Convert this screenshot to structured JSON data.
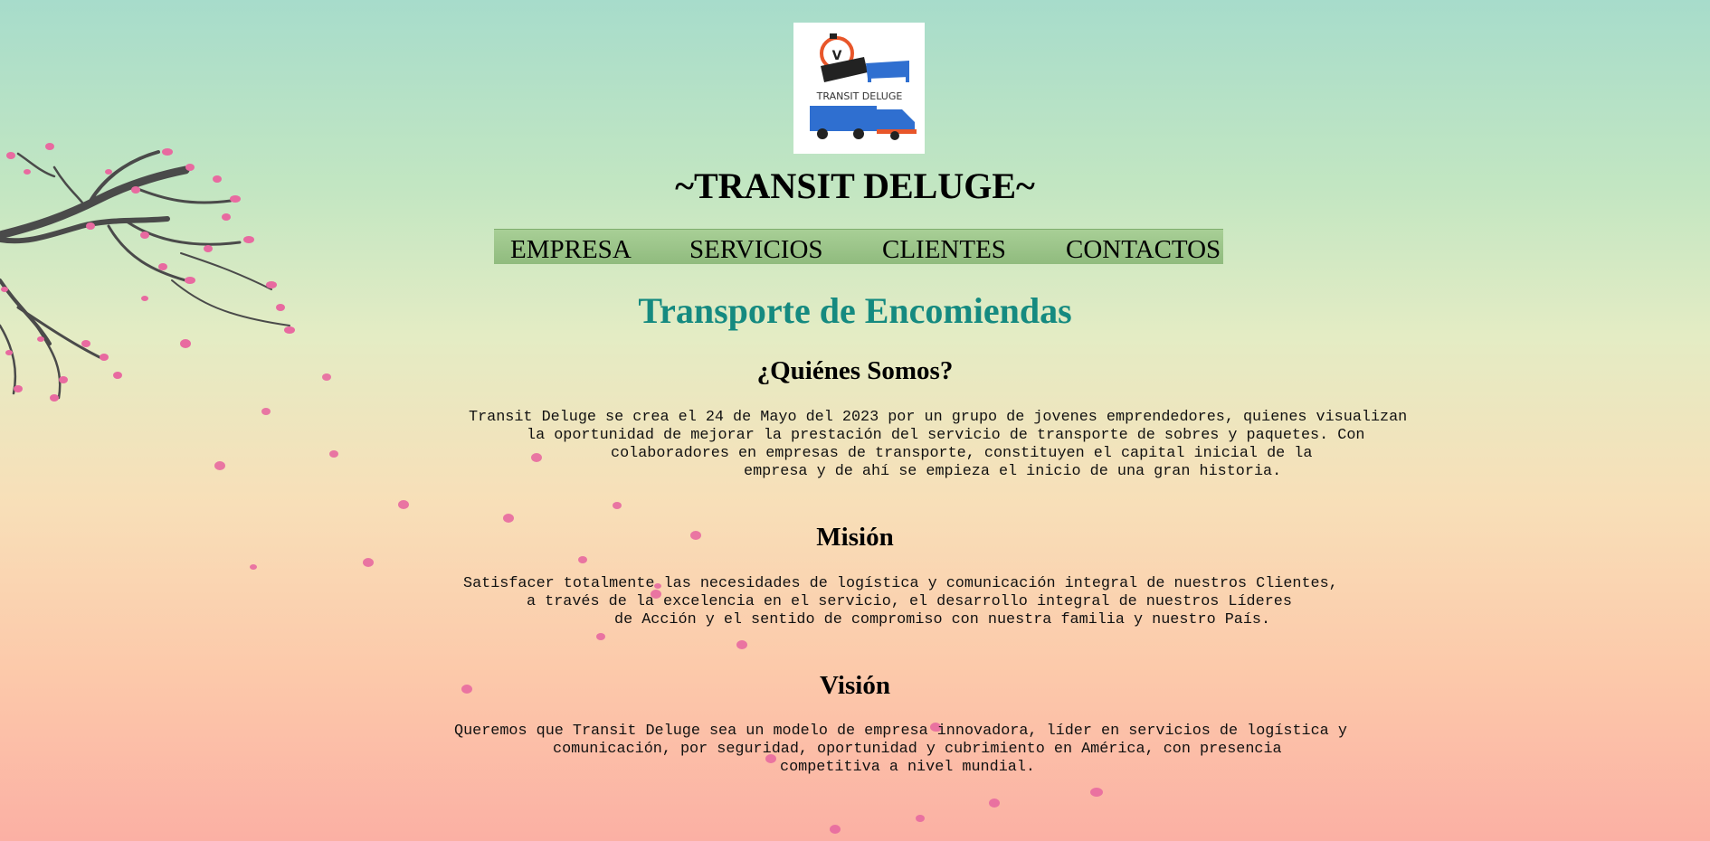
{
  "brand": {
    "logo_text": "TRANSIT DELUGE",
    "site_title": "~TRANSIT DELUGE~"
  },
  "nav": {
    "items": [
      "EMPRESA",
      "SERVICIOS",
      "CLIENTES",
      "CONTACTOS"
    ]
  },
  "main": {
    "heading": "Transporte de Encomiendas",
    "sections": [
      {
        "title": "¿Quiénes Somos?",
        "lines": [
          "Transit Deluge se crea el 24 de Mayo del 2023 por un grupo de jovenes emprendedores, quienes visualizan",
          "la oportunidad de mejorar la prestación del servicio de transporte de sobres y paquetes. Con",
          "colaboradores en empresas de transporte, constituyen el capital inicial de la",
          "empresa y de ahí se empieza el inicio de una gran historia."
        ]
      },
      {
        "title": "Misión",
        "lines": [
          "Satisfacer totalmente las necesidades de logística y comunicación integral de nuestros Clientes,",
          "a través de la excelencia en el servicio, el desarrollo integral de nuestros Líderes",
          "de Acción y el sentido de compromiso con nuestra familia y nuestro País."
        ]
      },
      {
        "title": "Visión",
        "lines": [
          "Queremos que Transit Deluge sea un modelo de empresa innovadora, líder en servicios de logística y",
          "comunicación, por seguridad, oportunidad y cubrimiento en América, con presencia",
          "competitiva a nivel mundial."
        ]
      }
    ]
  },
  "colors": {
    "heading_teal": "#158a80",
    "nav_green": "#9fc98c",
    "petal_pink": "#e86aa0",
    "branch_gray": "#555555",
    "logo_orange": "#e8562a",
    "logo_blue": "#2f6fd0"
  }
}
